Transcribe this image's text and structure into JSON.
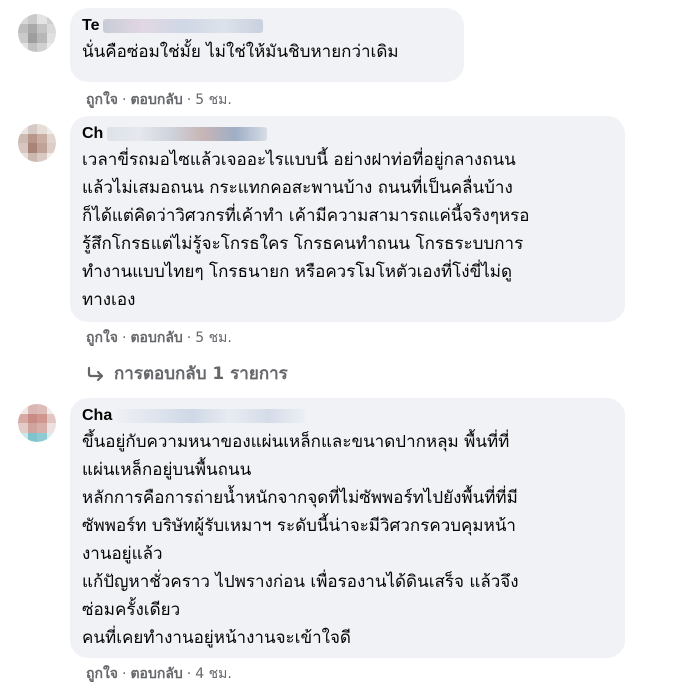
{
  "comments": [
    {
      "author": "Te",
      "text": "นั่นคือซ่อมใช่มั้ย ไม่ใช่ให้มันชิบหายกว่าเดิม",
      "like_label": "ถูกใจ",
      "reply_label": "ตอบกลับ",
      "time": "5 ชม."
    },
    {
      "author": "Ch",
      "text": "เวลาขี่รถมอไซแล้วเจออะไรแบบนี้ อย่างฝาท่อที่อยู่กลางถนน\nแล้วไม่เสมอถนน กระแทกคอสะพานบ้าง ถนนที่เป็นคลื่นบ้าง\nก็ได้แต่คิดว่าวิศวกรที่เค้าทำ เค้ามีความสามารถแค่นี้จริงๆหรอ\nรู้สึกโกรธแต่ไม่รู้จะโกรธใคร โกรธคนทำถนน โกรธระบบการ\nทำงานแบบไทยๆ โกรธนายก หรือควรโมโหตัวเองที่โง่ขี่ไม่ดู\nทางเอง",
      "like_label": "ถูกใจ",
      "reply_label": "ตอบกลับ",
      "time": "5 ชม.",
      "replies_label": "การตอบกลับ 1 รายการ"
    },
    {
      "author": "Cha",
      "text": "ขึ้นอยู่กับความหนาของแผ่นเหล็กและขนาดปากหลุม พื้นที่ที่\nแผ่นเหล็กอยู่บนพื้นถนน\nหลักการคือการถ่ายน้ำหนักจากจุดที่ไม่ซัพพอร์ทไปยังพื้นที่ที่มี\nซัพพอร์ท บริษัทผู้รับเหมาฯ ระดับนี้น่าจะมีวิศวกรควบคุมหน้า\nงานอยู่แล้ว\nแก้ปัญหาชั่วคราว ไปพรางก่อน เพื่อรองานได้ดินเสร็จ แล้วจึง\nซ่อมครั้งเดียว\nคนที่เคยทำงานอยู่หน้างานจะเข้าใจดี",
      "like_label": "ถูกใจ",
      "reply_label": "ตอบกลับ",
      "time": "4 ชม."
    }
  ],
  "colors": {
    "bubble": "#f0f2f5",
    "meta_text": "#65676b",
    "body_text": "#050505"
  }
}
